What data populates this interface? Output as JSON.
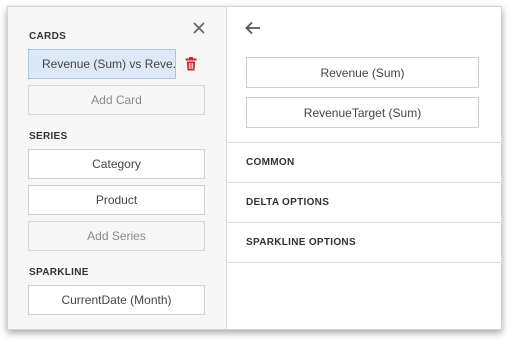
{
  "left": {
    "cards_title": "CARDS",
    "cards": [
      {
        "label": "Revenue (Sum) vs Reve..."
      }
    ],
    "add_card_label": "Add Card",
    "series_title": "SERIES",
    "series": [
      {
        "label": "Category"
      },
      {
        "label": "Product"
      }
    ],
    "add_series_label": "Add Series",
    "sparkline_title": "SPARKLINE",
    "sparkline_value": "CurrentDate (Month)"
  },
  "right": {
    "values": [
      {
        "label": "Revenue (Sum)"
      },
      {
        "label": "RevenueTarget (Sum)"
      }
    ],
    "sections": [
      {
        "label": "COMMON"
      },
      {
        "label": "DELTA OPTIONS"
      },
      {
        "label": "SPARKLINE OPTIONS"
      }
    ]
  },
  "icons": {
    "close": "close-icon",
    "delete": "trash-icon",
    "back": "arrow-left-icon"
  },
  "colors": {
    "selected_bg": "#dde9f8",
    "selected_border": "#a9c4e6",
    "delete_red": "#c62828"
  }
}
